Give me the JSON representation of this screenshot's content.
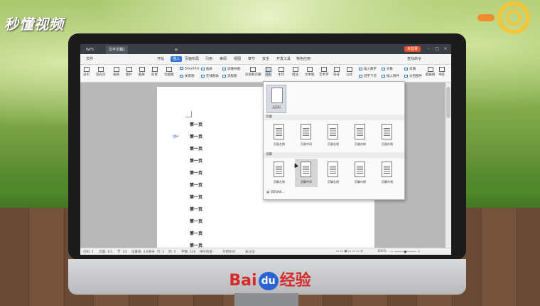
{
  "watermark": {
    "brand": "秒懂视频"
  },
  "footer_logo": {
    "bai": "Bai",
    "du": "du",
    "text": "经验"
  },
  "app": {
    "tabs": [
      {
        "label": "WPS"
      },
      {
        "label": "文字文稿1"
      }
    ],
    "new_tab": "+",
    "login": "未登录",
    "menus": [
      "文件",
      "开始",
      "插入",
      "页面布局",
      "引用",
      "审阅",
      "视图",
      "章节",
      "安全",
      "开发工具",
      "特色应用"
    ],
    "active_menu": "插入",
    "search": "查找命令"
  },
  "ribbon": {
    "buttons": [
      "分页",
      "空白页",
      "表格",
      "图片",
      "截屏",
      "形状",
      "功能图",
      "页眉和页脚",
      "页码",
      "水印",
      "批注",
      "文本框",
      "艺术字",
      "符号",
      "公式",
      "超链接",
      "书签"
    ],
    "small": [
      "SmartArt",
      "图表",
      "关系图",
      "在线图表",
      "思维导图",
      "流程图",
      "插入数字",
      "对象",
      "首字下沉",
      "插入附件",
      "日期",
      "文档部件"
    ]
  },
  "document": {
    "lines": [
      "第一页",
      "第一页",
      "第一页",
      "第一页",
      "第一页",
      "第一页",
      "第一页",
      "第一页",
      "第一页",
      "第一页",
      "第一页"
    ]
  },
  "page_number_menu": {
    "blank_label": "无页码",
    "header_section": "页眉",
    "header_items": [
      "页眉左侧",
      "页眉中间",
      "页眉右侧",
      "页眉内侧",
      "页眉外侧"
    ],
    "footer_section": "页脚",
    "footer_items": [
      "页脚左侧",
      "页脚中间",
      "页脚右侧",
      "页脚内侧",
      "页脚外侧"
    ],
    "hovered_item": "页脚中间",
    "more": "页码(N)..."
  },
  "status_bar": {
    "page_num": "页码: 1",
    "pages": "页面: 1/3",
    "section": "节: 1/1",
    "setting": "设置值: 3.6厘米",
    "row": "行: 2",
    "col": "列: 4",
    "words": "字数: 120",
    "spell": "拼写检查",
    "doc_check": "文档校对",
    "cert": "未认证",
    "zoom": "100%"
  }
}
